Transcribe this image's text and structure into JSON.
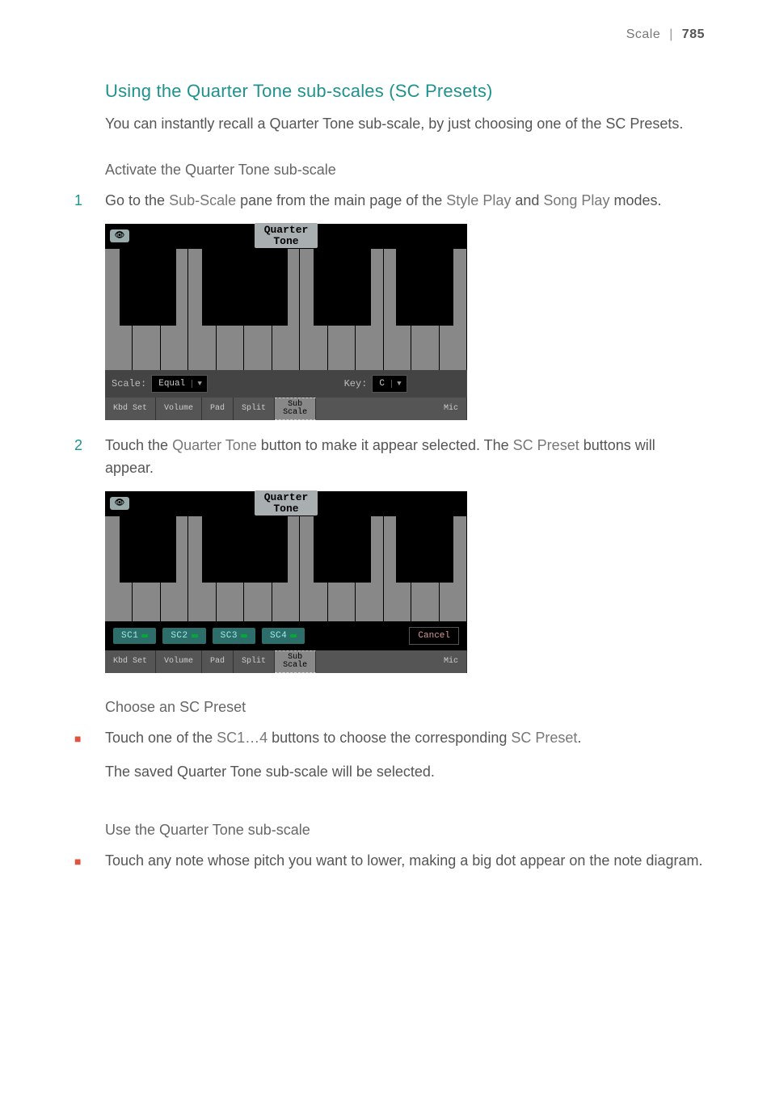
{
  "header": {
    "section": "Scale",
    "page_number": "785"
  },
  "title": "Using the Quarter Tone sub-scales (SC Presets)",
  "intro": "You can instantly recall a Quarter Tone sub-scale, by just choosing one of the SC Presets.",
  "sub1": "Activate the Quarter Tone sub-scale",
  "step1": {
    "n": "1",
    "pre": "Go to the ",
    "e1": "Sub-Scale",
    "mid1": " pane from the main page of the ",
    "e2": "Style Play",
    "mid2": " and ",
    "e3": "Song Play",
    "post": " modes."
  },
  "device_common": {
    "qt_button": "Quarter\nTone",
    "scale_label": "Scale:",
    "scale_value": "Equal",
    "key_label": "Key:",
    "key_value": "C",
    "tabs": [
      "Kbd Set",
      "Volume",
      "Pad",
      "Split",
      "Sub\nScale",
      "Mic"
    ],
    "sc_buttons": [
      "SC1",
      "SC2",
      "SC3",
      "SC4"
    ],
    "cancel": "Cancel"
  },
  "step2": {
    "n": "2",
    "pre": "Touch the ",
    "e1": "Quarter Tone",
    "mid": " button to make it appear selected. The ",
    "e2": "SC Preset",
    "post": " buttons will appear."
  },
  "sub2": "Choose an SC Preset",
  "bullet1": {
    "pre": "Touch one of the ",
    "e1": "SC1…4",
    "mid": " buttons to choose the corresponding ",
    "e2": "SC Preset",
    "post": "."
  },
  "bullet1_cont": "The saved Quarter Tone sub-scale will be selected.",
  "sub3": "Use the Quarter Tone sub-scale",
  "bullet2": "Touch any note whose pitch you want to lower, making a big dot appear on the note diagram."
}
